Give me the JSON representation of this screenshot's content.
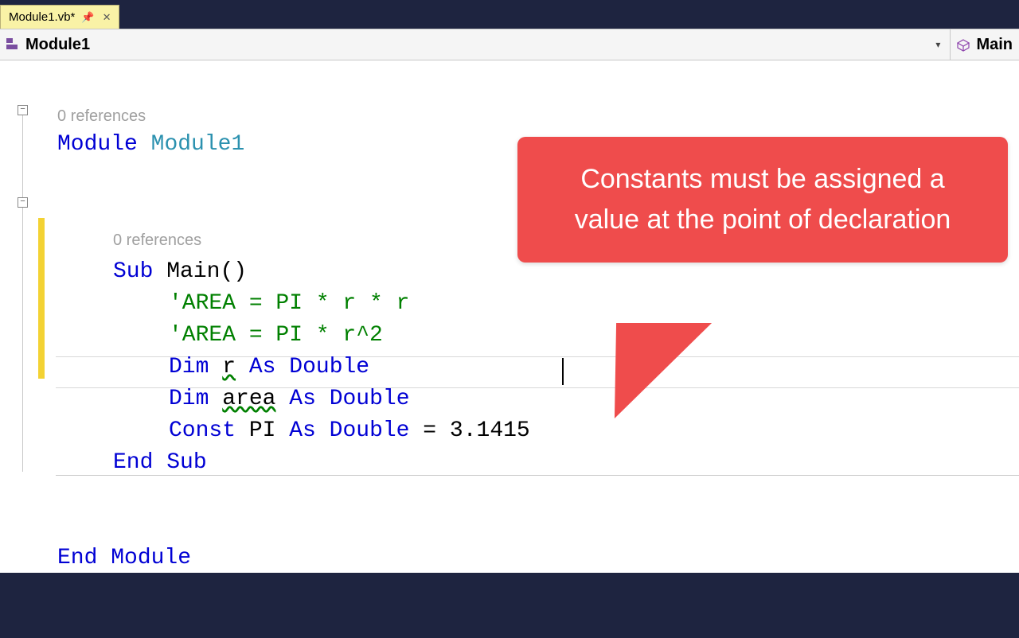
{
  "tab": {
    "filename": "Module1.vb*"
  },
  "nav": {
    "module": "Module1",
    "member": "Main"
  },
  "refs": {
    "module": "0 references",
    "sub": "0 references"
  },
  "code": {
    "module_kw": "Module",
    "module_name": "Module1",
    "sub_kw": "Sub",
    "sub_name": "Main()",
    "comment1": "'AREA = PI * r * r",
    "comment2": "'AREA = PI * r^2",
    "dim1_pre": "Dim",
    "dim1_var": "r",
    "dim1_as": "As",
    "dim1_type": "Double",
    "dim2_pre": "Dim",
    "dim2_var": "area",
    "dim2_as": "As",
    "dim2_type": "Double",
    "const_kw": "Const",
    "const_name": "PI",
    "const_as": "As",
    "const_type": "Double",
    "const_eq": " = 3.1415",
    "end_sub": "End Sub",
    "end_module": "End Module"
  },
  "callout": {
    "text": "Constants must be assigned a value at the point of declaration"
  }
}
